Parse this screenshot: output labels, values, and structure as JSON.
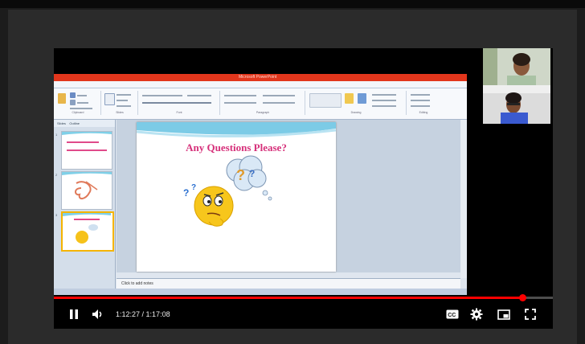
{
  "ppt": {
    "window_title": "Microsoft PowerPoint",
    "tabs": [
      "File",
      "Home",
      "Insert",
      "Design",
      "Transitions",
      "Animations",
      "Slide Show",
      "Review",
      "View",
      "Easy Document Creator"
    ],
    "ribbon_groups": [
      "Clipboard",
      "Slides",
      "Font",
      "Paragraph",
      "Drawing",
      "Editing"
    ],
    "panel_tabs": [
      "Slides",
      "Outline"
    ],
    "slide_numbers": [
      "1",
      "2",
      "3"
    ],
    "notes_placeholder": "Click to add notes",
    "slide_title": "Any Questions Please?"
  },
  "webcams": [
    {
      "name": ""
    },
    {
      "name": ""
    }
  ],
  "player": {
    "current_time": "1:12:27",
    "separator": " / ",
    "duration": "1:17:08",
    "progress": 0.9395,
    "accent_color": "#ff0000",
    "icons": [
      "pause-icon",
      "volume-icon",
      "captions-icon",
      "settings-icon",
      "miniplayer-icon",
      "fullscreen-icon"
    ]
  }
}
